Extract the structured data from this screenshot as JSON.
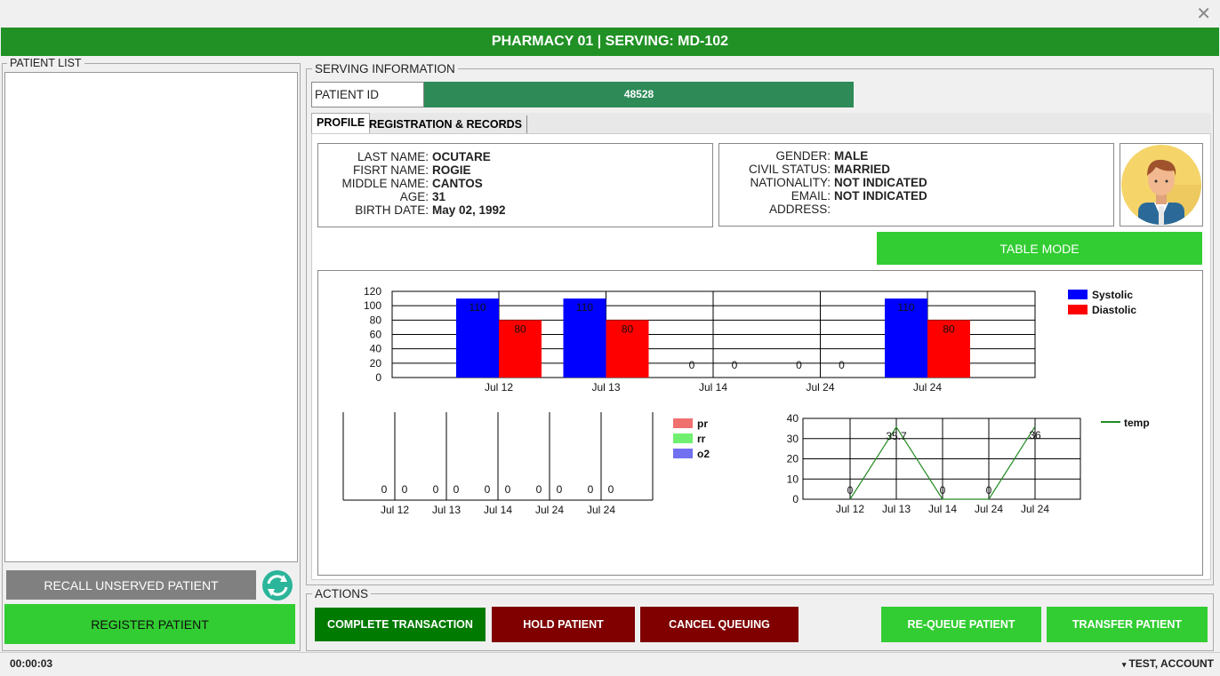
{
  "window": {
    "close_glyph": "✕"
  },
  "header": {
    "title": "PHARMACY 01 | SERVING: MD-102"
  },
  "patient_list": {
    "legend": "PATIENT LIST"
  },
  "left_buttons": {
    "recall": "RECALL UNSERVED PATIENT",
    "register": "REGISTER PATIENT",
    "refresh_icon": "refresh-icon"
  },
  "serving": {
    "legend": "SERVING INFORMATION",
    "patient_id_label": "PATIENT ID",
    "patient_id_value": "48528",
    "tabs": [
      "PROFILE",
      "REGISTRATION & RECORDS"
    ]
  },
  "profile": {
    "left": [
      {
        "label": "LAST NAME:",
        "value": "OCUTARE"
      },
      {
        "label": "FISRT NAME:",
        "value": "ROGIE"
      },
      {
        "label": "MIDDLE NAME:",
        "value": "CANTOS"
      },
      {
        "label": "AGE:",
        "value": "31"
      },
      {
        "label": "BIRTH DATE:",
        "value": "May 02, 1992"
      }
    ],
    "right": [
      {
        "label": "GENDER:",
        "value": "MALE"
      },
      {
        "label": "CIVIL STATUS:",
        "value": "MARRIED"
      },
      {
        "label": "NATIONALITY:",
        "value": "NOT INDICATED"
      },
      {
        "label": "EMAIL:",
        "value": "NOT INDICATED"
      },
      {
        "label": "ADDRESS:",
        "value": ""
      }
    ],
    "avatar_icon": "user-avatar-icon"
  },
  "table_mode_label": "TABLE MODE",
  "chart_data": [
    {
      "type": "bar",
      "categories": [
        "Jul 12",
        "Jul 13",
        "Jul 14",
        "Jul 24",
        "Jul 24"
      ],
      "series": [
        {
          "name": "Systolic",
          "values": [
            110,
            110,
            0,
            0,
            110
          ],
          "color": "#0000ff"
        },
        {
          "name": "Diastolic",
          "values": [
            80,
            80,
            0,
            0,
            80
          ],
          "color": "#ff0000"
        }
      ],
      "y_ticks": [
        "0",
        "20",
        "40",
        "60",
        "80",
        "100",
        "120"
      ],
      "ylim": [
        0,
        120
      ],
      "grid": true,
      "legend_position": "top-right"
    },
    {
      "type": "bar",
      "categories": [
        "Jul 12",
        "Jul 13",
        "Jul 14",
        "Jul 24",
        "Jul 24"
      ],
      "series": [
        {
          "name": "pr",
          "values": [
            0,
            0,
            0,
            0,
            0
          ],
          "color": "#f07070"
        },
        {
          "name": "rr",
          "values": [
            0,
            0,
            0,
            0,
            0
          ],
          "color": "#70f070"
        },
        {
          "name": "o2",
          "values": [
            0,
            0,
            0,
            0,
            0
          ],
          "color": "#7070f0"
        }
      ],
      "point_labels": [
        "0",
        "0",
        "0",
        "0",
        "0",
        "0",
        "0",
        "0",
        "0",
        "0"
      ],
      "grid": true,
      "legend_position": "top-right"
    },
    {
      "type": "line",
      "categories": [
        "Jul 12",
        "Jul 13",
        "Jul 14",
        "Jul 24",
        "Jul 24"
      ],
      "series": [
        {
          "name": "temp",
          "values": [
            0,
            35.7,
            0,
            0,
            36
          ],
          "labels": [
            "0",
            "35.7",
            "0",
            "0",
            "36"
          ],
          "color": "#228b22"
        }
      ],
      "y_ticks": [
        "0",
        "10",
        "20",
        "30",
        "40"
      ],
      "ylim": [
        0,
        40
      ],
      "grid": true,
      "legend_position": "top-right"
    }
  ],
  "actions": {
    "legend": "ACTIONS",
    "complete": "COMPLETE TRANSACTION",
    "hold": "HOLD PATIENT",
    "cancel": "CANCEL QUEUING",
    "requeue": "RE-QUEUE PATIENT",
    "transfer": "TRANSFER PATIENT"
  },
  "status": {
    "timer": "00:00:03",
    "account_arrow": "▾",
    "account": "TEST, ACCOUNT"
  },
  "colors": {
    "header": "#219125",
    "accent_green": "#32cd32",
    "patient_id_bar": "#2e8b57",
    "maroon": "#800000",
    "dark_green": "#007a00"
  }
}
